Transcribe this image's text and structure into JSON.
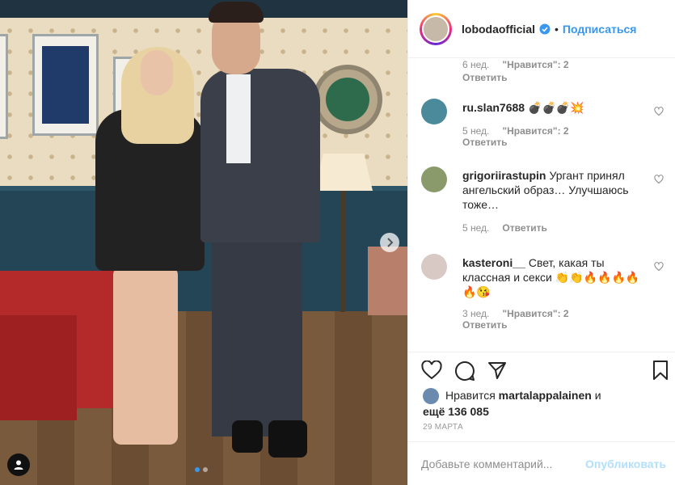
{
  "post": {
    "username": "lobodaofficial",
    "separator": "•",
    "follow_label": "Подписаться",
    "likes_prefix": "Нравится",
    "likes_user": "martalappalainen",
    "likes_and": "и",
    "likes_more": "ещё 136 085",
    "date": "29 марта",
    "add_comment_placeholder": "Добавьте комментарий...",
    "publish_label": "Опубликовать",
    "carousel": {
      "total": 2,
      "current": 1
    }
  },
  "comments": [
    {
      "username": "",
      "text": "",
      "age": "6 нед.",
      "likes": "\"Нравится\": 2",
      "reply": "Ответить"
    },
    {
      "username": "ru.slan7688",
      "text": "💣💣💣💥",
      "age": "5 нед.",
      "likes": "\"Нравится\": 2",
      "reply": "Ответить",
      "avatar_color": "#4b8a9a"
    },
    {
      "username": "grigoriirastupin",
      "text": "Ургант принял ангельский образ… Улучшаюсь тоже…",
      "age": "5 нед.",
      "likes": "",
      "reply": "Ответить",
      "avatar_color": "#8a9a6a"
    },
    {
      "username": "kasteroni__",
      "text": "Свет, какая ты классная и секси 👏👏🔥🔥🔥🔥🔥😘",
      "age": "3 нед.",
      "likes": "\"Нравится\": 2",
      "reply": "Ответить",
      "avatar_color": "#d9c9c4"
    }
  ],
  "colors": {
    "link": "#3897f0",
    "muted": "#8e8e8e",
    "border": "#efefef"
  },
  "icons": [
    "verified-badge-icon",
    "heart-icon",
    "comment-icon",
    "share-icon",
    "bookmark-icon",
    "chevron-right-icon",
    "user-tag-icon"
  ]
}
